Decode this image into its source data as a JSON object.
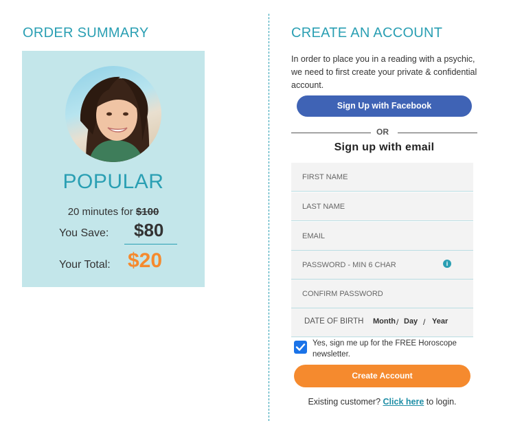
{
  "order_summary": {
    "heading": "ORDER SUMMARY",
    "tier": "POPULAR",
    "minutes_text": "20 minutes for ",
    "original_price": "$100",
    "save_label": "You Save:",
    "save_amount": "$80",
    "total_label": "Your Total:",
    "total_amount": "$20"
  },
  "create_account": {
    "heading": "CREATE AN ACCOUNT",
    "intro": "In order to place you in a reading with a psychic, we need to first create your private & confidential account.",
    "facebook_button": "Sign Up with Facebook",
    "or_text": "OR",
    "email_heading": "Sign up with email",
    "fields": {
      "first_name_placeholder": "FIRST NAME",
      "last_name_placeholder": "LAST NAME",
      "email_placeholder": "EMAIL",
      "password_placeholder": "PASSWORD - MIN 6 CHAR",
      "confirm_password_placeholder": "CONFIRM PASSWORD"
    },
    "dob": {
      "label": "DATE OF BIRTH",
      "month": "Month",
      "day": "Day",
      "year": "Year",
      "separator": "/"
    },
    "newsletter_checked": true,
    "newsletter_text": "Yes, sign me up for the FREE Horoscope newsletter.",
    "create_button": "Create Account",
    "existing_prefix": "Existing customer? ",
    "existing_link": "Click here",
    "existing_suffix": " to login."
  },
  "colors": {
    "accent": "#2a9fb3",
    "card_bg": "#c3e6ea",
    "facebook": "#3f63b5",
    "orange": "#f58a2e",
    "checkbox": "#1a73e8"
  },
  "icons": [
    "avatar-photo",
    "info-icon",
    "checkmark-icon"
  ]
}
